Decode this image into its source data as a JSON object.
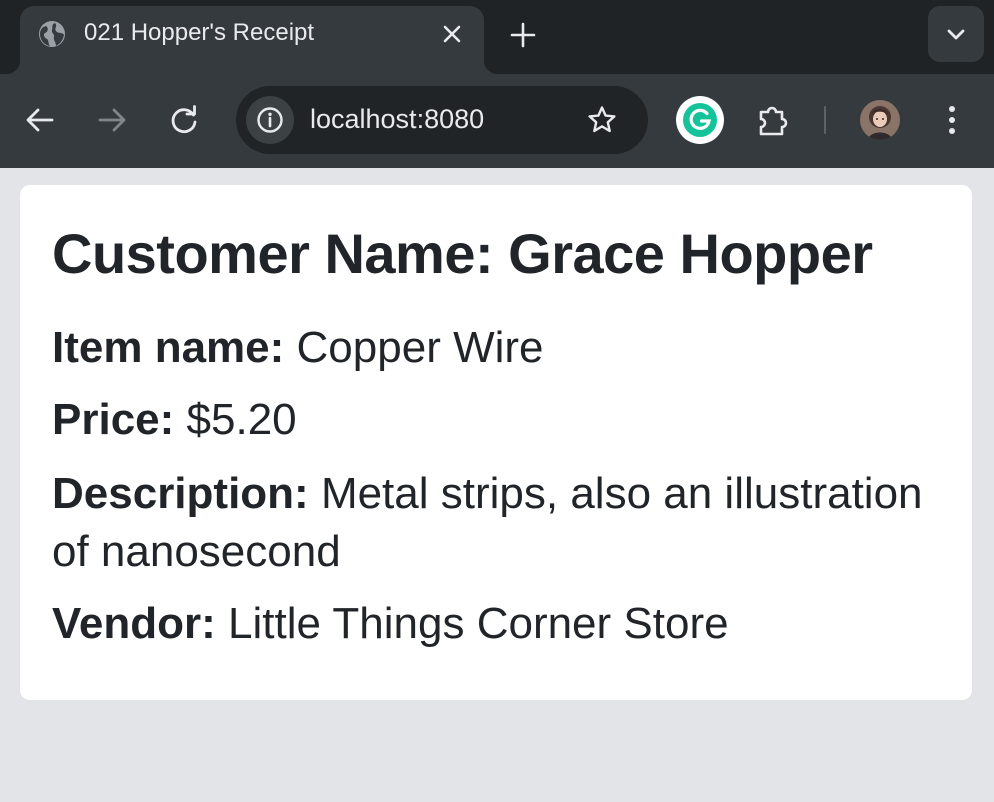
{
  "browser": {
    "tab": {
      "title": "021 Hopper's Receipt",
      "favicon_icon": "globe-icon",
      "close_icon": "close-icon"
    },
    "new_tab_icon": "plus-icon",
    "tab_search_icon": "chevron-down-icon",
    "toolbar": {
      "back_icon": "arrow-left-icon",
      "forward_icon": "arrow-right-icon",
      "reload_icon": "reload-icon",
      "site_info_icon": "info-icon",
      "url": "localhost:8080",
      "bookmark_icon": "star-icon",
      "grammarly_icon": "grammarly-icon",
      "extensions_icon": "puzzle-icon",
      "profile_icon": "avatar",
      "menu_icon": "kebab-menu-icon"
    },
    "colors": {
      "tabstrip": "#1f2326",
      "toolbar": "#353a3e",
      "omnibox": "#202427",
      "page_background": "#e3e4e7",
      "grammarly_green": "#15c39a"
    }
  },
  "receipt": {
    "heading": "Customer Name: Grace Hopper",
    "fields": [
      {
        "label": "Item name:",
        "value": "Copper Wire"
      },
      {
        "label": "Price:",
        "value": "$5.20"
      },
      {
        "label": "Description:",
        "value": "Metal strips, also an illustration of nanosecond"
      },
      {
        "label": "Vendor:",
        "value": "Little Things Corner Store"
      }
    ]
  }
}
